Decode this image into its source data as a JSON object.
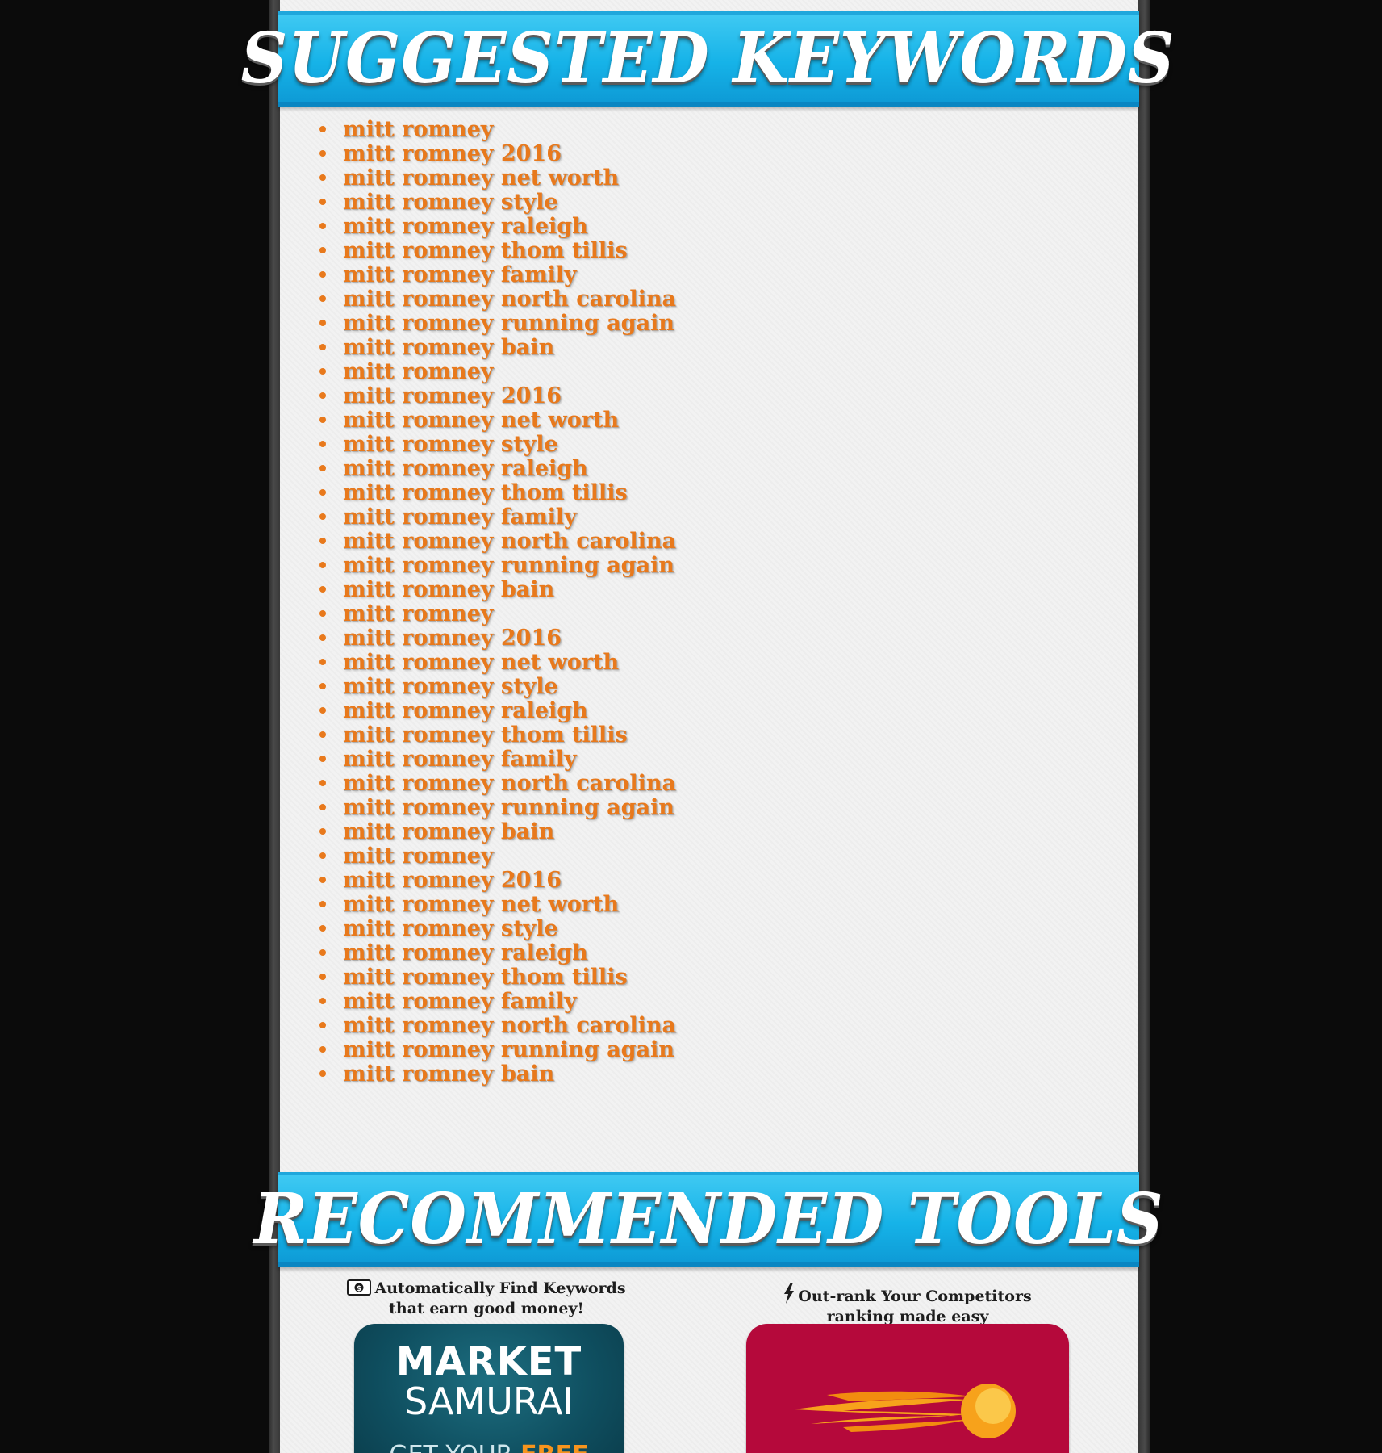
{
  "sections": {
    "suggested_title": "SUGGESTED KEYWORDS",
    "recommended_title": "RECOMMENDED TOOLS"
  },
  "keywords": [
    "mitt romney",
    "mitt romney 2016",
    "mitt romney net worth",
    "mitt romney style",
    "mitt romney raleigh",
    "mitt romney thom tillis",
    "mitt romney family",
    "mitt romney north carolina",
    "mitt romney running again",
    "mitt romney bain",
    "mitt romney",
    "mitt romney 2016",
    "mitt romney net worth",
    "mitt romney style",
    "mitt romney raleigh",
    "mitt romney thom tillis",
    "mitt romney family",
    "mitt romney north carolina",
    "mitt romney running again",
    "mitt romney bain",
    "mitt romney",
    "mitt romney 2016",
    "mitt romney net worth",
    "mitt romney style",
    "mitt romney raleigh",
    "mitt romney thom tillis",
    "mitt romney family",
    "mitt romney north carolina",
    "mitt romney running again",
    "mitt romney bain",
    "mitt romney",
    "mitt romney 2016",
    "mitt romney net worth",
    "mitt romney style",
    "mitt romney raleigh",
    "mitt romney thom tillis",
    "mitt romney family",
    "mitt romney north carolina",
    "mitt romney running again",
    "mitt romney bain"
  ],
  "tools": [
    {
      "icon": "money-icon",
      "caption_line1": "Automatically Find Keywords",
      "caption_line2": "that earn good money!",
      "logo_word1": "MARKET",
      "logo_word2": "SAMURAI",
      "cta_prefix": "GET YOUR",
      "cta_accent": "FREE"
    },
    {
      "icon": "bolt-icon",
      "caption_line1": "Out-rank Your Competitors",
      "caption_line2": "ranking made easy"
    }
  ],
  "colors": {
    "keyword": "#e8791c",
    "banner": "#16b3e8",
    "panel": "#f2f2f2",
    "background": "#0b0b0b",
    "samurai_card": "#0f4f60",
    "seo_card": "#b5093b"
  }
}
